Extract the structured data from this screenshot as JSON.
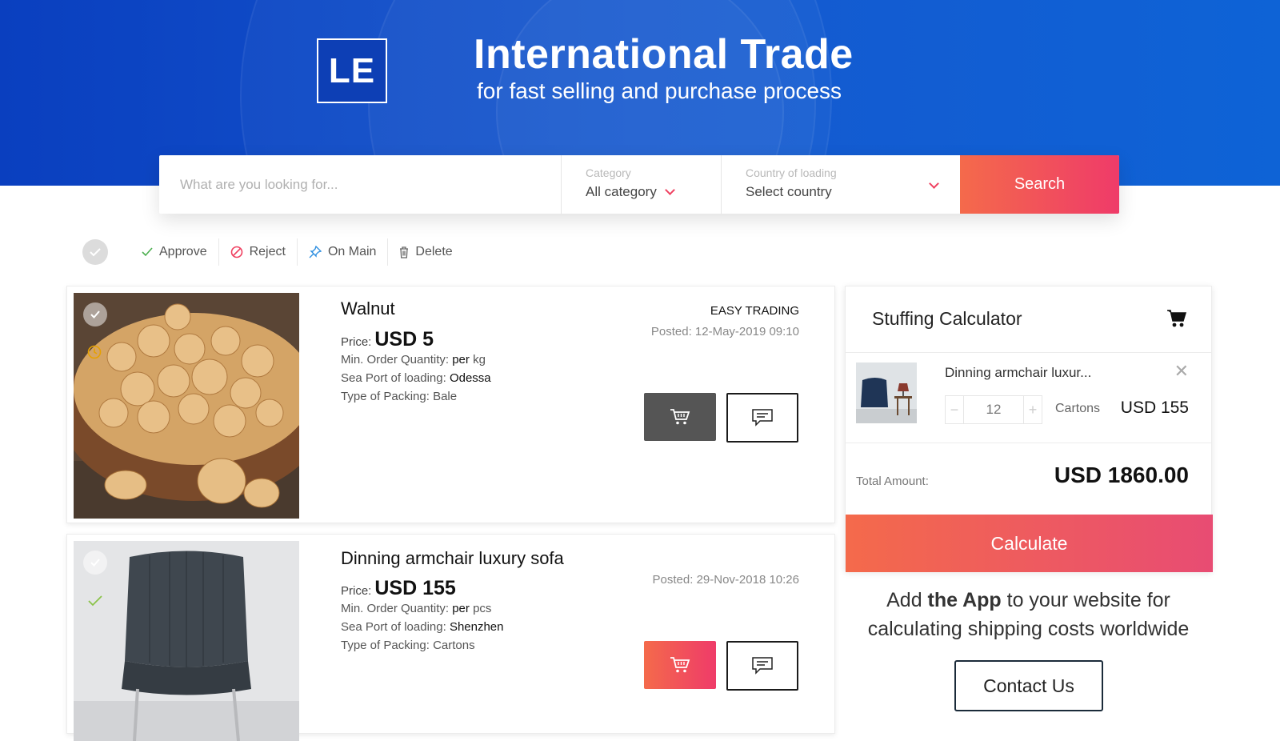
{
  "brand": {
    "logo_text": "LE",
    "title": "International Trade",
    "subtitle": "for fast selling and purchase process"
  },
  "search": {
    "placeholder": "What are you looking for...",
    "category_label": "Category",
    "category_value": "All category",
    "country_label": "Country of loading",
    "country_value": "Select country",
    "button_label": "Search"
  },
  "toolbar": {
    "approve": "Approve",
    "reject": "Reject",
    "on_main": "On Main",
    "delete": "Delete"
  },
  "listings": [
    {
      "title": "Walnut",
      "price_label": "Price:",
      "price": "USD 5",
      "moq_label": "Min. Order Quantity:",
      "moq_per": "per",
      "moq_unit": "kg",
      "port_label": "Sea Port of loading:",
      "port": "Odessa",
      "packing_label": "Type of Packing:",
      "packing": "Bale",
      "seller": "EASY TRADING",
      "posted": "Posted: 12-May-2019 09:10",
      "cart_color": "#555555"
    },
    {
      "title": "Dinning armchair luxury sofa",
      "price_label": "Price:",
      "price": "USD 155",
      "moq_label": "Min. Order Quantity:",
      "moq_per": "per",
      "moq_unit": "pcs",
      "port_label": "Sea Port of loading:",
      "port": "Shenzhen",
      "packing_label": "Type of Packing:",
      "packing": "Cartons",
      "seller": "",
      "posted": "Posted: 29-Nov-2018 10:26",
      "cart_color": "#ef4060"
    }
  ],
  "calculator": {
    "title": "Stuffing Calculator",
    "item_name": "Dinning armchair luxur...",
    "quantity": "12",
    "unit": "Cartons",
    "item_price": "USD 155",
    "total_label": "Total Amount:",
    "total_value": "USD 1860.00",
    "button_label": "Calculate"
  },
  "promo": {
    "line1_pre": "Add ",
    "line1_bold": "the App",
    "line1_post": " to your website for",
    "line2": "calculating shipping costs worldwide",
    "contact_label": "Contact Us"
  },
  "colors": {
    "hero_blue": "#1558cf",
    "accent_red": "#ef4060",
    "accent_orange": "#f46a4b"
  }
}
